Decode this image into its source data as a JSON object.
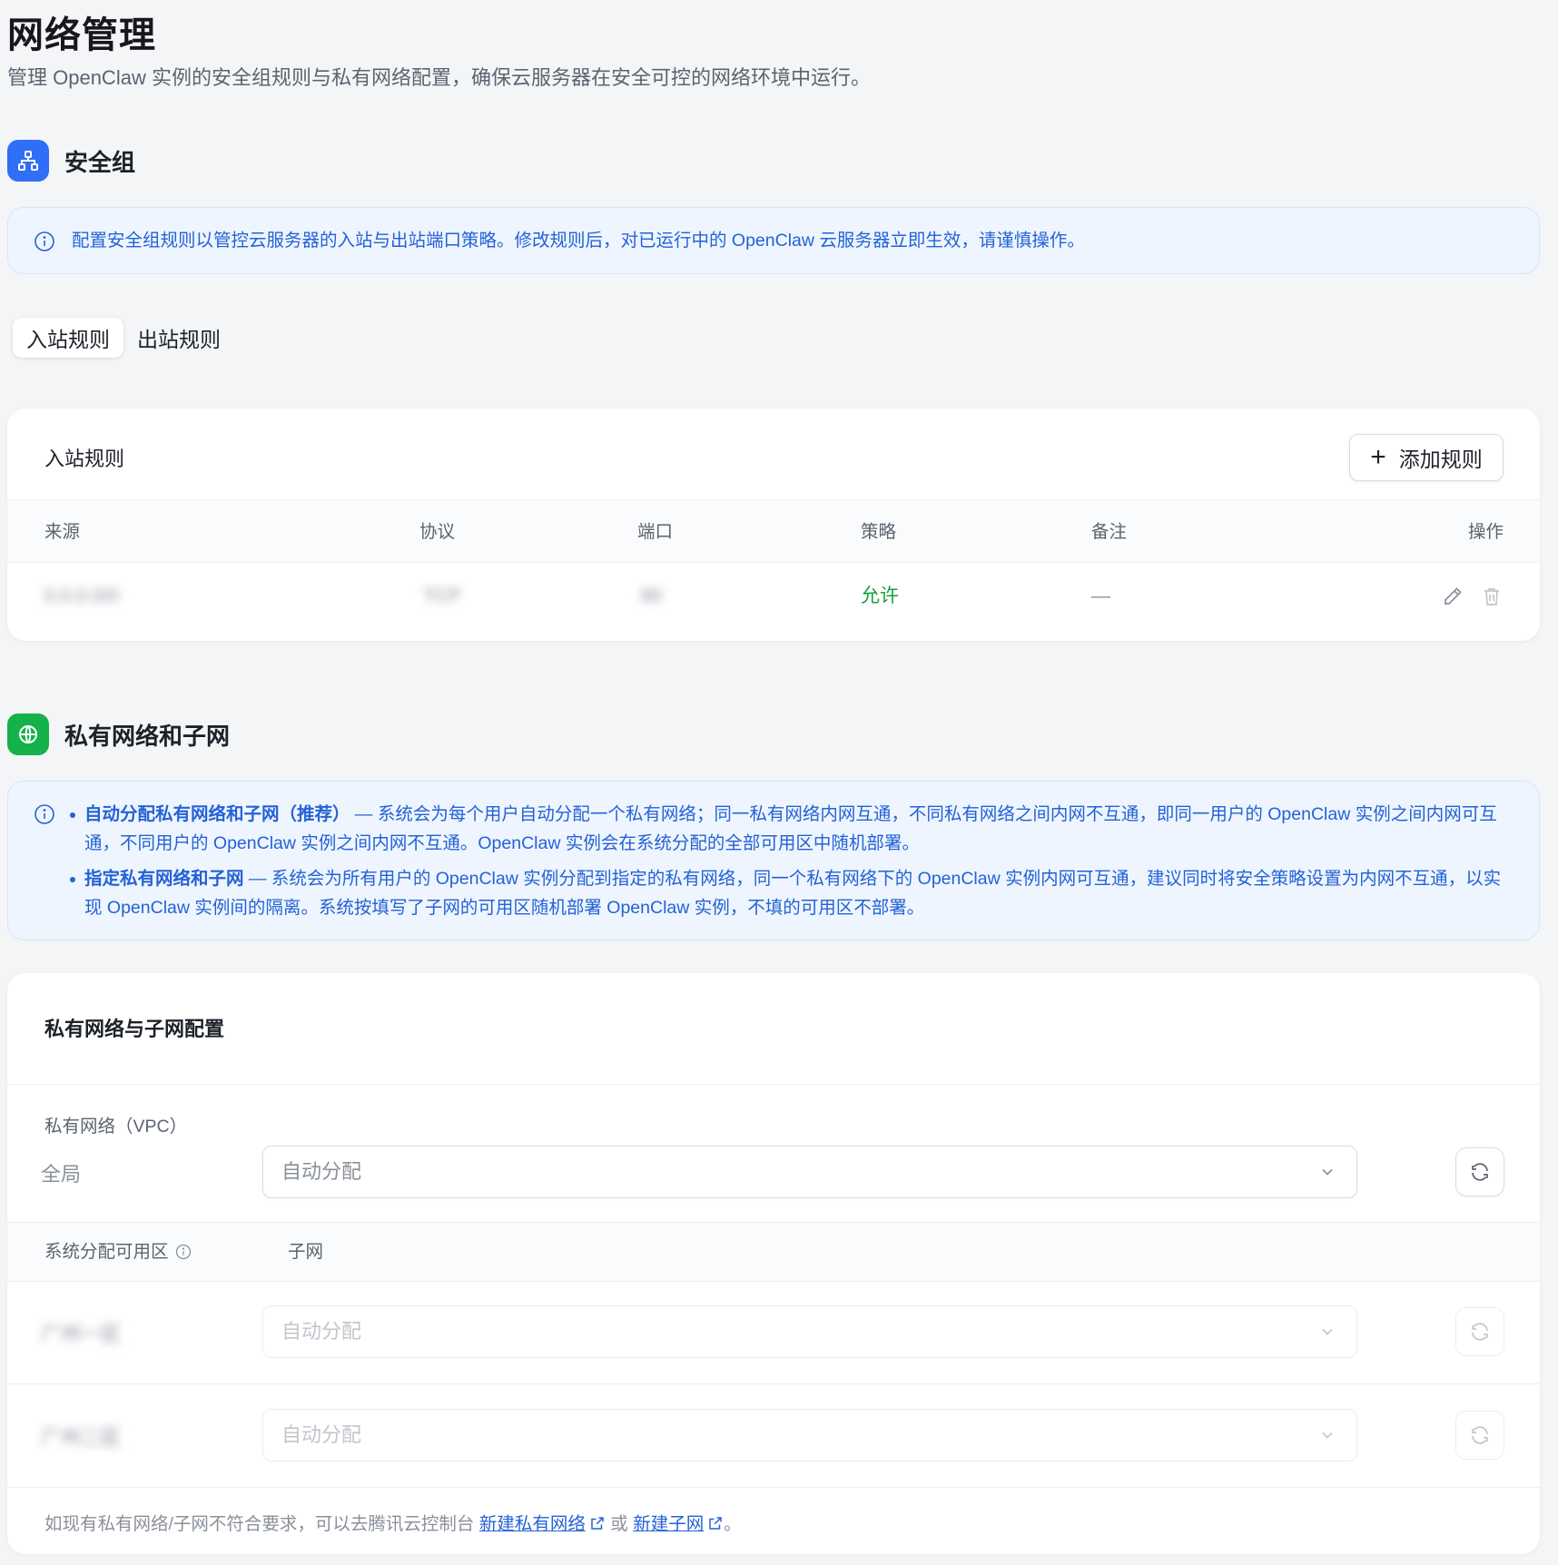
{
  "page": {
    "title": "网络管理",
    "description": "管理 OpenClaw 实例的安全组规则与私有网络配置，确保云服务器在安全可控的网络环境中运行。"
  },
  "security_group": {
    "title": "安全组",
    "icon": "network-icon",
    "notice": "配置安全组规则以管控云服务器的入站与出站端口策略。修改规则后，对已运行中的 OpenClaw 云服务器立即生效，请谨慎操作。",
    "tabs": [
      {
        "label": "入站规则",
        "active": true
      },
      {
        "label": "出站规则",
        "active": false
      }
    ],
    "card_title": "入站规则",
    "add_button": "添加规则",
    "columns": [
      "来源",
      "协议",
      "端口",
      "策略",
      "备注",
      "操作"
    ],
    "rows": [
      {
        "source": "0.0.0.0/0",
        "protocol": "TCP",
        "port": "80",
        "policy": "允许",
        "remark": "—"
      }
    ],
    "colors": {
      "accent": "#2f6ef7",
      "allow": "#15a13f"
    }
  },
  "vpc": {
    "title": "私有网络和子网",
    "icon": "globe-icon",
    "notice_items": [
      {
        "strong": "自动分配私有网络和子网（推荐）",
        "text": " — 系统会为每个用户自动分配一个私有网络；同一私有网络内网互通，不同私有网络之间内网不互通，即同一用户的 OpenClaw 实例之间内网可互通，不同用户的 OpenClaw 实例之间内网不互通。OpenClaw 实例会在系统分配的全部可用区中随机部署。"
      },
      {
        "strong": "指定私有网络和子网",
        "text": " — 系统会为所有用户的 OpenClaw 实例分配到指定的私有网络，同一个私有网络下的 OpenClaw 实例内网可互通，建议同时将安全策略设置为内网不互通，以实现 OpenClaw 实例间的隔离。系统按填写了子网的可用区随机部署 OpenClaw 实例，不填的可用区不部署。"
      }
    ],
    "card_title": "私有网络与子网配置",
    "vpc_label": "私有网络（VPC）",
    "scope_label": "全局",
    "vpc_select": "自动分配",
    "zone_header": "系统分配可用区",
    "subnet_header": "子网",
    "zones": [
      {
        "name": "广州一区",
        "subnet": "自动分配"
      },
      {
        "name": "广州二区",
        "subnet": "自动分配"
      }
    ],
    "footer_prefix": "如现有私有网络/子网不符合要求，可以去腾讯云控制台",
    "footer_link1": "新建私有网络",
    "footer_or": "或",
    "footer_link2": "新建子网",
    "footer_suffix": "。",
    "colors": {
      "accent": "#15b24a",
      "link": "#2462d6"
    }
  }
}
